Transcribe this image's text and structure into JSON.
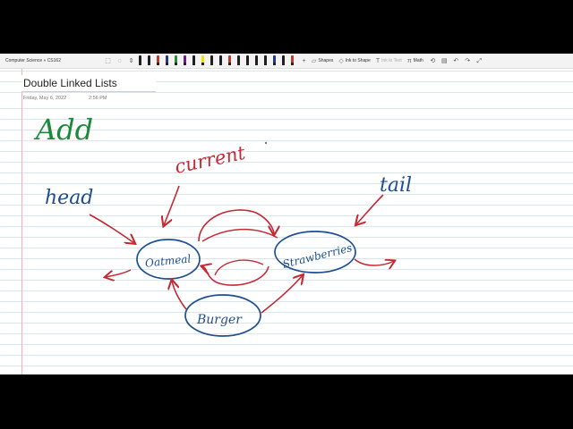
{
  "toolbar": {
    "breadcrumb": "Computer Science » CS162",
    "shapes_label": "Shapes",
    "ink_to_shape_label": "Ink to Shape",
    "ink_to_text_label": "Ink to Text",
    "math_label": "Math",
    "pen_colors": [
      "#1f1f1f",
      "#1f1f1f",
      "#c0392b",
      "#1f3a93",
      "#2e8b3a",
      "#6a1b9a",
      "#1f1f1f",
      "#f1e10a",
      "#1f1f1f",
      "#1f1f1f",
      "#c0392b",
      "#1f1f1f",
      "#1f1f1f",
      "#1f1f1f",
      "#1f1f1f",
      "#1f3a93",
      "#1f1f1f",
      "#c0392b"
    ]
  },
  "page": {
    "title": "Double Linked Lists",
    "date": "Friday, May 6, 2022",
    "time": "2:56 PM"
  },
  "ink": {
    "add": "Add",
    "current": "current",
    "head": "head",
    "tail": "tail",
    "nodes": [
      "Oatmeal",
      "Strawberries",
      "Burger"
    ]
  },
  "colors": {
    "blue_ink": "#1d4e8f",
    "red_ink": "#c42a33",
    "green_ink": "#1a8a3a"
  }
}
